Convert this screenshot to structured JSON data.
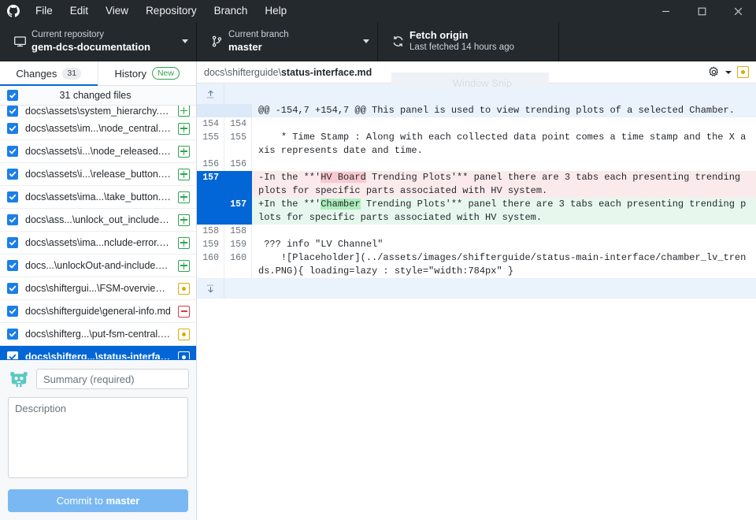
{
  "titlebar": {
    "logo_icon": "github-logo-icon",
    "menus": [
      "File",
      "Edit",
      "View",
      "Repository",
      "Branch",
      "Help"
    ],
    "window_controls": {
      "minimize": "minimize-icon",
      "maximize": "maximize-icon",
      "close": "close-icon"
    }
  },
  "toolbar": {
    "repository": {
      "icon": "desktop-monitor-icon",
      "label": "Current repository",
      "value": "gem-dcs-documentation"
    },
    "branch": {
      "icon": "branch-icon",
      "label": "Current branch",
      "value": "master"
    },
    "fetch": {
      "icon": "sync-refresh-icon",
      "label": "Fetch origin",
      "value": "Last fetched 14 hours ago"
    }
  },
  "tabs": [
    {
      "label": "Changes",
      "count": "31",
      "active": true
    },
    {
      "label": "History",
      "badge": "New",
      "active": false
    }
  ],
  "changes": {
    "header": "31 changed files",
    "all_checked": true,
    "files": [
      {
        "name": "docs\\assets\\system_hierarchy.PNG",
        "status": "added",
        "checked": true,
        "clipped": true
      },
      {
        "name": "docs\\assets\\im...\\node_central.PNG",
        "status": "added",
        "checked": true
      },
      {
        "name": "docs\\assets\\i...\\node_released.PNG",
        "status": "added",
        "checked": true
      },
      {
        "name": "docs\\assets\\i...\\release_button.PNG",
        "status": "added",
        "checked": true
      },
      {
        "name": "docs\\assets\\ima...\\take_button.PNG",
        "status": "added",
        "checked": true
      },
      {
        "name": "docs\\ass...\\unlock_out_include.PNG",
        "status": "added",
        "checked": true
      },
      {
        "name": "docs\\assets\\ima...nclude-error.png",
        "status": "added",
        "checked": true
      },
      {
        "name": "docs...\\unlockOut-and-include.png",
        "status": "added",
        "checked": true
      },
      {
        "name": "docs\\shiftergui...\\FSM-overview.md",
        "status": "modified",
        "checked": true
      },
      {
        "name": "docs\\shifterguide\\general-info.md",
        "status": "deleted",
        "checked": true
      },
      {
        "name": "docs\\shifterg...\\put-fsm-central.md",
        "status": "modified",
        "checked": true
      },
      {
        "name": "docs\\shifterg...\\status-interface.md",
        "status": "modified",
        "checked": true,
        "selected": true
      }
    ]
  },
  "commit": {
    "avatar_icon": "octocat-avatar-icon",
    "summary_placeholder": "Summary (required)",
    "summary_value": "",
    "description_placeholder": "Description",
    "description_value": "",
    "button_prefix": "Commit to ",
    "button_branch": "master"
  },
  "diff_header": {
    "path_prefix": "docs\\shifterguide\\",
    "path_file": "status-interface.md",
    "gear_icon": "gear-icon",
    "caret_icon": "chevron-down-icon",
    "status_icon": "modified-status-icon"
  },
  "diff": {
    "expand_up_icon": "expand-up-icon",
    "expand_down_icon": "expand-down-icon",
    "lines": [
      {
        "type": "hunk",
        "old": "",
        "new": "",
        "text": "@@ -154,7 +154,7 @@ This panel is used to view trending plots of a selected Chamber."
      },
      {
        "type": "context",
        "old": "154",
        "new": "154",
        "text": ""
      },
      {
        "type": "context",
        "old": "155",
        "new": "155",
        "text": "    * Time Stamp : Along with each collected data point comes a time stamp and the X axis represents date and time."
      },
      {
        "type": "context",
        "old": "156",
        "new": "156",
        "text": ""
      },
      {
        "type": "del",
        "old": "157",
        "new": "",
        "selected": true,
        "prefix": "-In the **'",
        "highlight": "HV Board",
        "suffix": " Trending Plots'** panel there are 3 tabs each presenting trending plots for specific parts associated with HV system."
      },
      {
        "type": "add",
        "old": "",
        "new": "157",
        "selected": true,
        "prefix": "+In the **'",
        "highlight": "Chamber",
        "suffix": " Trending Plots'** panel there are 3 tabs each presenting trending plots for specific parts associated with HV system."
      },
      {
        "type": "context",
        "old": "158",
        "new": "158",
        "text": ""
      },
      {
        "type": "context",
        "old": "159",
        "new": "159",
        "text": " ??? info \"LV Channel\""
      },
      {
        "type": "context",
        "old": "160",
        "new": "160",
        "text": "    ![Placeholder](../assets/images/shifterguide/status-main-interface/chamber_lv_trends.PNG){ loading=lazy : style=\"width:784px\" }"
      }
    ]
  },
  "watermark": {
    "text": "Window Snip"
  }
}
